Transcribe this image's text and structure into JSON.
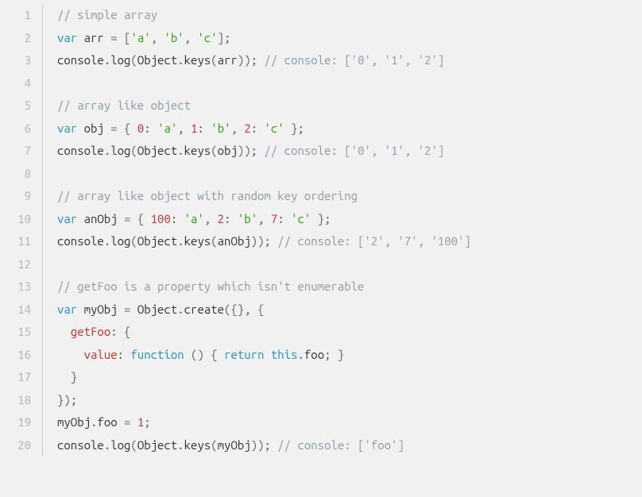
{
  "total_lines": 20,
  "code": {
    "lines": [
      [
        {
          "t": "comment",
          "v": "// simple array"
        }
      ],
      [
        {
          "t": "keyword",
          "v": "var"
        },
        {
          "t": "ident",
          "v": " arr "
        },
        {
          "t": "punct",
          "v": "="
        },
        {
          "t": "ident",
          "v": " "
        },
        {
          "t": "punct",
          "v": "["
        },
        {
          "t": "string",
          "v": "'a'"
        },
        {
          "t": "punct",
          "v": ","
        },
        {
          "t": "ident",
          "v": " "
        },
        {
          "t": "string",
          "v": "'b'"
        },
        {
          "t": "punct",
          "v": ","
        },
        {
          "t": "ident",
          "v": " "
        },
        {
          "t": "string",
          "v": "'c'"
        },
        {
          "t": "punct",
          "v": "];"
        }
      ],
      [
        {
          "t": "ident",
          "v": "console"
        },
        {
          "t": "punct",
          "v": "."
        },
        {
          "t": "func",
          "v": "log"
        },
        {
          "t": "punct",
          "v": "("
        },
        {
          "t": "ident",
          "v": "Object"
        },
        {
          "t": "punct",
          "v": "."
        },
        {
          "t": "func",
          "v": "keys"
        },
        {
          "t": "punct",
          "v": "("
        },
        {
          "t": "ident",
          "v": "arr"
        },
        {
          "t": "punct",
          "v": "));"
        },
        {
          "t": "ident",
          "v": " "
        },
        {
          "t": "comment",
          "v": "// console: ['0', '1', '2']"
        }
      ],
      [],
      [
        {
          "t": "comment",
          "v": "// array like object"
        }
      ],
      [
        {
          "t": "keyword",
          "v": "var"
        },
        {
          "t": "ident",
          "v": " obj "
        },
        {
          "t": "punct",
          "v": "="
        },
        {
          "t": "ident",
          "v": " "
        },
        {
          "t": "punct",
          "v": "{"
        },
        {
          "t": "ident",
          "v": " "
        },
        {
          "t": "number",
          "v": "0"
        },
        {
          "t": "punct",
          "v": ":"
        },
        {
          "t": "ident",
          "v": " "
        },
        {
          "t": "string",
          "v": "'a'"
        },
        {
          "t": "punct",
          "v": ","
        },
        {
          "t": "ident",
          "v": " "
        },
        {
          "t": "number",
          "v": "1"
        },
        {
          "t": "punct",
          "v": ":"
        },
        {
          "t": "ident",
          "v": " "
        },
        {
          "t": "string",
          "v": "'b'"
        },
        {
          "t": "punct",
          "v": ","
        },
        {
          "t": "ident",
          "v": " "
        },
        {
          "t": "number",
          "v": "2"
        },
        {
          "t": "punct",
          "v": ":"
        },
        {
          "t": "ident",
          "v": " "
        },
        {
          "t": "string",
          "v": "'c'"
        },
        {
          "t": "ident",
          "v": " "
        },
        {
          "t": "punct",
          "v": "};"
        }
      ],
      [
        {
          "t": "ident",
          "v": "console"
        },
        {
          "t": "punct",
          "v": "."
        },
        {
          "t": "func",
          "v": "log"
        },
        {
          "t": "punct",
          "v": "("
        },
        {
          "t": "ident",
          "v": "Object"
        },
        {
          "t": "punct",
          "v": "."
        },
        {
          "t": "func",
          "v": "keys"
        },
        {
          "t": "punct",
          "v": "("
        },
        {
          "t": "ident",
          "v": "obj"
        },
        {
          "t": "punct",
          "v": "));"
        },
        {
          "t": "ident",
          "v": " "
        },
        {
          "t": "comment",
          "v": "// console: ['0', '1', '2']"
        }
      ],
      [],
      [
        {
          "t": "comment",
          "v": "// array like object with random key ordering"
        }
      ],
      [
        {
          "t": "keyword",
          "v": "var"
        },
        {
          "t": "ident",
          "v": " anObj "
        },
        {
          "t": "punct",
          "v": "="
        },
        {
          "t": "ident",
          "v": " "
        },
        {
          "t": "punct",
          "v": "{"
        },
        {
          "t": "ident",
          "v": " "
        },
        {
          "t": "number",
          "v": "100"
        },
        {
          "t": "punct",
          "v": ":"
        },
        {
          "t": "ident",
          "v": " "
        },
        {
          "t": "string",
          "v": "'a'"
        },
        {
          "t": "punct",
          "v": ","
        },
        {
          "t": "ident",
          "v": " "
        },
        {
          "t": "number",
          "v": "2"
        },
        {
          "t": "punct",
          "v": ":"
        },
        {
          "t": "ident",
          "v": " "
        },
        {
          "t": "string",
          "v": "'b'"
        },
        {
          "t": "punct",
          "v": ","
        },
        {
          "t": "ident",
          "v": " "
        },
        {
          "t": "number",
          "v": "7"
        },
        {
          "t": "punct",
          "v": ":"
        },
        {
          "t": "ident",
          "v": " "
        },
        {
          "t": "string",
          "v": "'c'"
        },
        {
          "t": "ident",
          "v": " "
        },
        {
          "t": "punct",
          "v": "};"
        }
      ],
      [
        {
          "t": "ident",
          "v": "console"
        },
        {
          "t": "punct",
          "v": "."
        },
        {
          "t": "func",
          "v": "log"
        },
        {
          "t": "punct",
          "v": "("
        },
        {
          "t": "ident",
          "v": "Object"
        },
        {
          "t": "punct",
          "v": "."
        },
        {
          "t": "func",
          "v": "keys"
        },
        {
          "t": "punct",
          "v": "("
        },
        {
          "t": "ident",
          "v": "anObj"
        },
        {
          "t": "punct",
          "v": "));"
        },
        {
          "t": "ident",
          "v": " "
        },
        {
          "t": "comment",
          "v": "// console: ['2', '7', '100']"
        }
      ],
      [],
      [
        {
          "t": "comment",
          "v": "// getFoo is a property which isn't enumerable"
        }
      ],
      [
        {
          "t": "keyword",
          "v": "var"
        },
        {
          "t": "ident",
          "v": " myObj "
        },
        {
          "t": "punct",
          "v": "="
        },
        {
          "t": "ident",
          "v": " Object"
        },
        {
          "t": "punct",
          "v": "."
        },
        {
          "t": "func",
          "v": "create"
        },
        {
          "t": "punct",
          "v": "({},"
        },
        {
          "t": "ident",
          "v": " "
        },
        {
          "t": "punct",
          "v": "{"
        }
      ],
      [
        {
          "t": "ident",
          "v": "  "
        },
        {
          "t": "prop",
          "v": "getFoo"
        },
        {
          "t": "punct",
          "v": ":"
        },
        {
          "t": "ident",
          "v": " "
        },
        {
          "t": "punct",
          "v": "{"
        }
      ],
      [
        {
          "t": "ident",
          "v": "    "
        },
        {
          "t": "prop",
          "v": "value"
        },
        {
          "t": "punct",
          "v": ":"
        },
        {
          "t": "ident",
          "v": " "
        },
        {
          "t": "keyword",
          "v": "function"
        },
        {
          "t": "ident",
          "v": " "
        },
        {
          "t": "punct",
          "v": "()"
        },
        {
          "t": "ident",
          "v": " "
        },
        {
          "t": "punct",
          "v": "{"
        },
        {
          "t": "ident",
          "v": " "
        },
        {
          "t": "keyword",
          "v": "return"
        },
        {
          "t": "ident",
          "v": " "
        },
        {
          "t": "keyword",
          "v": "this"
        },
        {
          "t": "punct",
          "v": "."
        },
        {
          "t": "ident",
          "v": "foo"
        },
        {
          "t": "punct",
          "v": ";"
        },
        {
          "t": "ident",
          "v": " "
        },
        {
          "t": "punct",
          "v": "}"
        }
      ],
      [
        {
          "t": "ident",
          "v": "  "
        },
        {
          "t": "punct",
          "v": "}"
        }
      ],
      [
        {
          "t": "punct",
          "v": "});"
        }
      ],
      [
        {
          "t": "ident",
          "v": "myObj"
        },
        {
          "t": "punct",
          "v": "."
        },
        {
          "t": "ident",
          "v": "foo "
        },
        {
          "t": "punct",
          "v": "="
        },
        {
          "t": "ident",
          "v": " "
        },
        {
          "t": "number",
          "v": "1"
        },
        {
          "t": "punct",
          "v": ";"
        }
      ],
      [
        {
          "t": "ident",
          "v": "console"
        },
        {
          "t": "punct",
          "v": "."
        },
        {
          "t": "func",
          "v": "log"
        },
        {
          "t": "punct",
          "v": "("
        },
        {
          "t": "ident",
          "v": "Object"
        },
        {
          "t": "punct",
          "v": "."
        },
        {
          "t": "func",
          "v": "keys"
        },
        {
          "t": "punct",
          "v": "("
        },
        {
          "t": "ident",
          "v": "myObj"
        },
        {
          "t": "punct",
          "v": "));"
        },
        {
          "t": "ident",
          "v": " "
        },
        {
          "t": "comment",
          "v": "// console: ['foo']"
        }
      ]
    ]
  }
}
